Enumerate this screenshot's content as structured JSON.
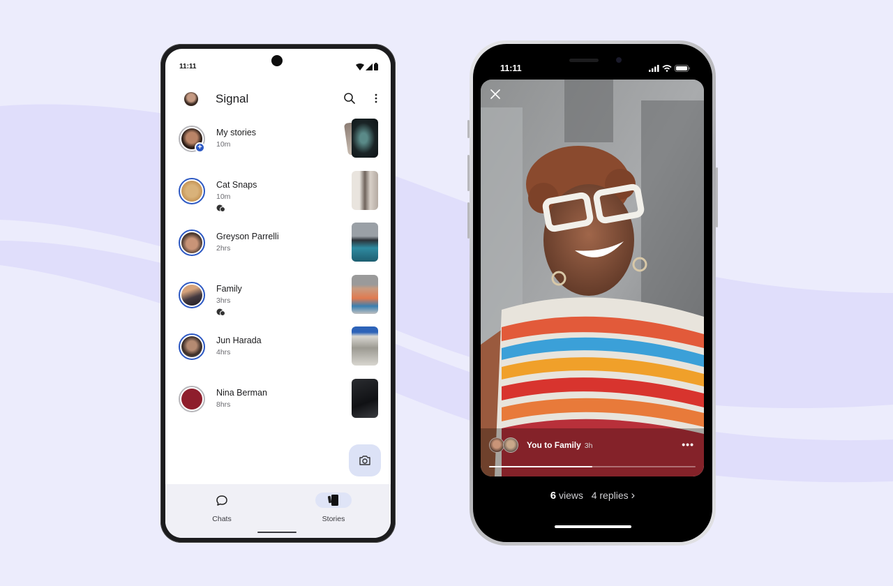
{
  "colors": {
    "background": "#ececfc",
    "wave": "#e0defb",
    "accent_blue": "#2c58c3",
    "fab_bg": "#dce2f6"
  },
  "android": {
    "status_time": "11:11",
    "app_title": "Signal",
    "icons": {
      "search": "search-icon",
      "more": "more-vertical-icon",
      "camera": "camera-icon"
    },
    "stories": [
      {
        "name": "My stories",
        "time": "10m",
        "has_replies": false,
        "viewed": true,
        "is_mine": true
      },
      {
        "name": "Cat Snaps",
        "time": "10m",
        "has_replies": true,
        "viewed": false,
        "is_mine": false
      },
      {
        "name": "Greyson Parrelli",
        "time": "2hrs",
        "has_replies": false,
        "viewed": false,
        "is_mine": false
      },
      {
        "name": "Family",
        "time": "3hrs",
        "has_replies": true,
        "viewed": false,
        "is_mine": false
      },
      {
        "name": "Jun Harada",
        "time": "4hrs",
        "has_replies": false,
        "viewed": false,
        "is_mine": false
      },
      {
        "name": "Nina Berman",
        "time": "8hrs",
        "has_replies": false,
        "viewed": true,
        "is_mine": false
      }
    ],
    "nav": [
      {
        "label": "Chats",
        "icon": "chat-bubble-icon",
        "active": false
      },
      {
        "label": "Stories",
        "icon": "stories-icon",
        "active": true
      }
    ]
  },
  "iphone": {
    "status_time": "11:11",
    "story": {
      "audience_text": "You to Family",
      "time": "3h",
      "progress": 0.5,
      "more_label": "•••"
    },
    "stats": {
      "views_count": "6",
      "views_label": "views",
      "replies_text": "4 replies",
      "chevron": "›"
    }
  }
}
